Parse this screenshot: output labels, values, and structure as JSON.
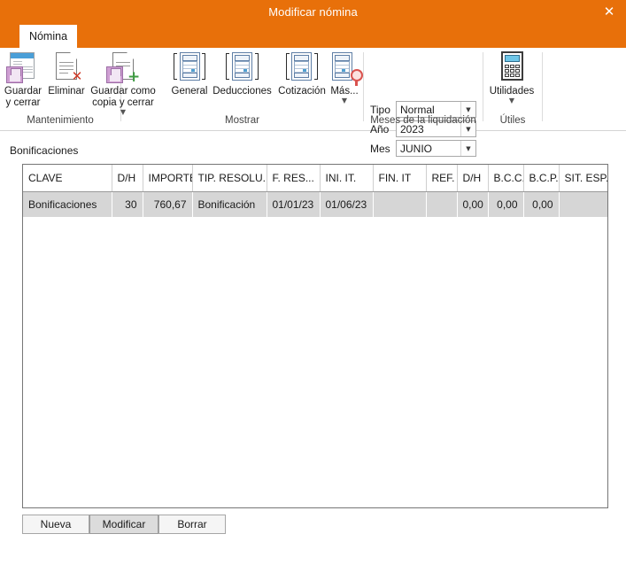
{
  "window": {
    "title": "Modificar nómina",
    "close_label": "✕",
    "accent_color": "#e8700a"
  },
  "tabs": [
    {
      "label": "Nómina",
      "active": true
    }
  ],
  "ribbon": {
    "groups": [
      {
        "name": "Mantenimiento",
        "label": "Mantenimiento",
        "buttons": [
          {
            "label": "Guardar\ny cerrar",
            "icon": "save-and-close-icon",
            "has_caret": false
          },
          {
            "label": "Eliminar",
            "icon": "delete-document-icon",
            "has_caret": false
          },
          {
            "label": "Guardar como\ncopia y cerrar",
            "icon": "save-as-copy-icon",
            "has_caret": true
          }
        ]
      },
      {
        "name": "Mostrar",
        "label": "Mostrar",
        "buttons": [
          {
            "label": "General",
            "icon": "report-general-icon",
            "has_caret": false
          },
          {
            "label": "Deducciones",
            "icon": "report-deductions-icon",
            "has_caret": false
          },
          {
            "label": "Cotización",
            "icon": "report-contribution-icon",
            "has_caret": false
          },
          {
            "label": "Más...",
            "icon": "report-more-seal-icon",
            "has_caret": true
          }
        ]
      },
      {
        "name": "Meses de la liquidación",
        "label": "Meses de la liquidación",
        "fields": [
          {
            "label": "Tipo",
            "value": "Normal"
          },
          {
            "label": "Año",
            "value": "2023"
          },
          {
            "label": "Mes",
            "value": "JUNIO"
          }
        ]
      },
      {
        "name": "Útiles",
        "label": "Útiles",
        "buttons": [
          {
            "label": "Utilidades",
            "icon": "calculator-icon",
            "has_caret": true
          }
        ]
      }
    ]
  },
  "content": {
    "section_label": "Bonificaciones",
    "table": {
      "columns": [
        "CLAVE",
        "D/H",
        "IMPORTE",
        "TIP. RESOLU...",
        "F. RES...",
        "INI. IT.",
        "FIN. IT",
        "REF.",
        "D/H",
        "B.C.C.",
        "B.C.P.",
        "SIT. ESP."
      ],
      "rows": [
        {
          "selected": true,
          "cells": [
            "Bonificaciones",
            "30",
            "760,67",
            "Bonificación",
            "01/01/23",
            "01/06/23",
            "",
            "",
            "0,00",
            "0,00",
            "0,00",
            ""
          ]
        }
      ]
    }
  },
  "footer": {
    "buttons": [
      {
        "label": "Nueva",
        "state": "normal"
      },
      {
        "label": "Modificar",
        "state": "highlighted"
      },
      {
        "label": "Borrar",
        "state": "normal"
      }
    ]
  }
}
